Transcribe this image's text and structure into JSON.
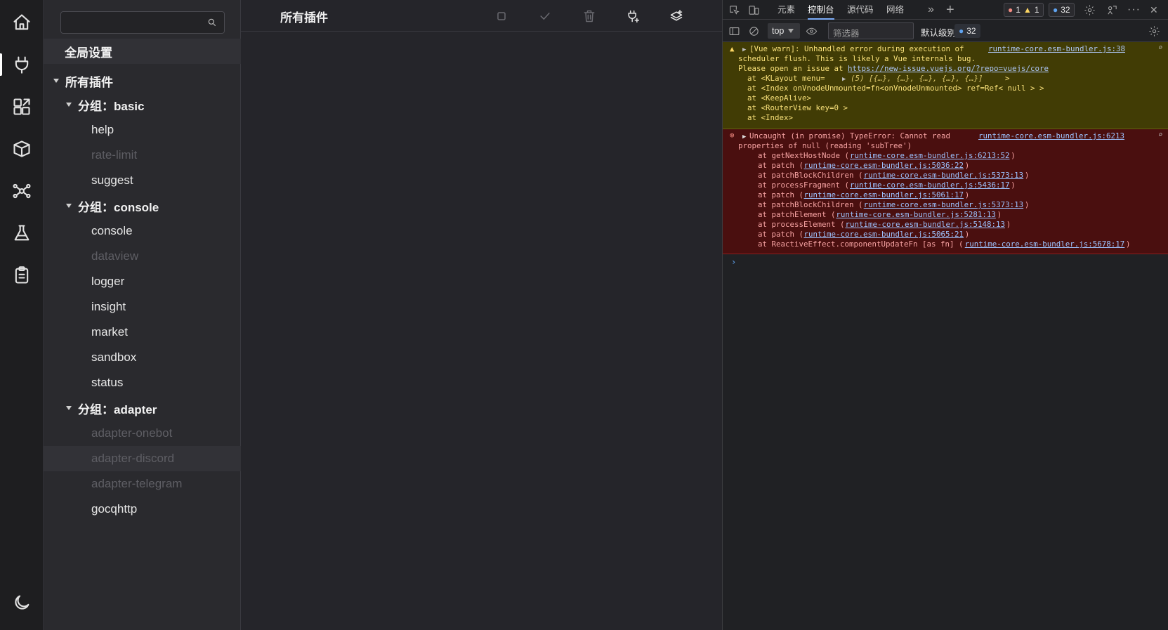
{
  "activity": {
    "items": [
      {
        "name": "home-icon"
      },
      {
        "name": "plug-icon"
      },
      {
        "name": "puzzle-icon"
      },
      {
        "name": "box-icon"
      },
      {
        "name": "network-icon"
      },
      {
        "name": "flask-icon"
      },
      {
        "name": "clipboard-icon"
      }
    ],
    "bottom": {
      "name": "moon-icon"
    }
  },
  "sidebar": {
    "search_placeholder": "",
    "global_settings": "全局设置",
    "all_plugins": "所有插件",
    "groups": [
      {
        "label": "分组：basic",
        "items": [
          {
            "label": "help",
            "disabled": false
          },
          {
            "label": "rate-limit",
            "disabled": true
          },
          {
            "label": "suggest",
            "disabled": false
          }
        ]
      },
      {
        "label": "分组：console",
        "items": [
          {
            "label": "console",
            "disabled": false
          },
          {
            "label": "dataview",
            "disabled": true
          },
          {
            "label": "logger",
            "disabled": false
          },
          {
            "label": "insight",
            "disabled": false
          },
          {
            "label": "market",
            "disabled": false
          },
          {
            "label": "sandbox",
            "disabled": false
          },
          {
            "label": "status",
            "disabled": false
          }
        ]
      },
      {
        "label": "分组：adapter",
        "items": [
          {
            "label": "adapter-onebot",
            "disabled": true
          },
          {
            "label": "adapter-discord",
            "disabled": true
          },
          {
            "label": "adapter-telegram",
            "disabled": true
          },
          {
            "label": "gocqhttp",
            "disabled": false
          }
        ]
      }
    ]
  },
  "main": {
    "title": "所有插件",
    "toolbar": [
      {
        "name": "square-icon",
        "enabled": false
      },
      {
        "name": "check-icon",
        "enabled": false
      },
      {
        "name": "trash-icon",
        "enabled": false
      },
      {
        "name": "add-plugin-icon",
        "enabled": true
      },
      {
        "name": "layers-add-icon",
        "enabled": true
      }
    ]
  },
  "devtools": {
    "tabs": [
      "元素",
      "控制台",
      "源代码",
      "网络"
    ],
    "active_tab": "控制台",
    "errors": "1",
    "warnings": "1",
    "messages": "32",
    "context": "top",
    "filter_placeholder": "筛选器",
    "level": "默认级别",
    "level_count": "32",
    "warn_lines": [
      "[Vue warn]: Unhandled error during execution of",
      "scheduler flush. This is likely a Vue internals bug.",
      "Please open an issue at ",
      "  at <KLayout menu= ",
      "  at <Index onVnodeUnmounted=fn<onVnodeUnmounted> ref=Ref< null > >",
      "  at <KeepAlive>",
      "  at <RouterView key=0 >",
      "  at <Index>"
    ],
    "warn_url": "https://new-issue.vuejs.org/?repo=vuejs/core",
    "warn_array": "(5) [{…}, {…}, {…}, {…}, {…}]",
    "warn_src": "runtime-core.esm-bundler.js:38",
    "err_lines": [
      "Uncaught (in promise) TypeError: Cannot read",
      "properties of null (reading 'subTree')"
    ],
    "err_src": "runtime-core.esm-bundler.js:6213",
    "stack": [
      {
        "fn": "at getNextHostNode (",
        "loc": "runtime-core.esm-bundler.js:6213:52"
      },
      {
        "fn": "at patch (",
        "loc": "runtime-core.esm-bundler.js:5036:22"
      },
      {
        "fn": "at patchBlockChildren (",
        "loc": "runtime-core.esm-bundler.js:5373:13"
      },
      {
        "fn": "at processFragment (",
        "loc": "runtime-core.esm-bundler.js:5436:17"
      },
      {
        "fn": "at patch (",
        "loc": "runtime-core.esm-bundler.js:5061:17"
      },
      {
        "fn": "at patchBlockChildren (",
        "loc": "runtime-core.esm-bundler.js:5373:13"
      },
      {
        "fn": "at patchElement (",
        "loc": "runtime-core.esm-bundler.js:5281:13"
      },
      {
        "fn": "at processElement (",
        "loc": "runtime-core.esm-bundler.js:5148:13"
      },
      {
        "fn": "at patch (",
        "loc": "runtime-core.esm-bundler.js:5065:21"
      },
      {
        "fn": "at ReactiveEffect.componentUpdateFn [as fn] (",
        "loc": "runtime-core.esm-bundler.js:5678:17"
      }
    ]
  }
}
